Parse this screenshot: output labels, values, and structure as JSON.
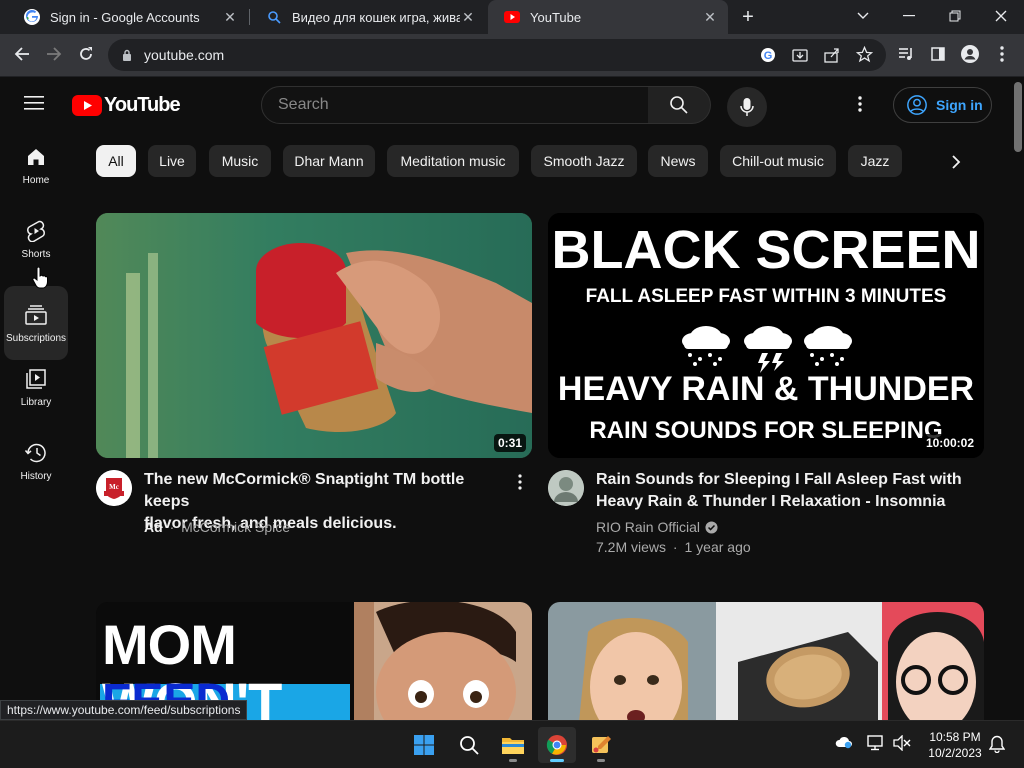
{
  "browser": {
    "tabs": [
      {
        "title": "Sign in - Google Accounts",
        "icon": "google-g-icon"
      },
      {
        "title": "Видео для кошек игра, живая м",
        "icon": "search-icon"
      },
      {
        "title": "YouTube",
        "icon": "youtube-icon",
        "active": true
      }
    ],
    "new_tab": "+",
    "url": "youtube.com",
    "status_url": "https://www.youtube.com/feed/subscriptions"
  },
  "youtube": {
    "logo_text": "YouTube",
    "search_placeholder": "Search",
    "sign_in": "Sign in",
    "guide": [
      {
        "label": "Home",
        "icon": "home-icon"
      },
      {
        "label": "Shorts",
        "icon": "shorts-icon"
      },
      {
        "label": "Subscriptions",
        "icon": "subscriptions-icon"
      },
      {
        "label": "Library",
        "icon": "library-icon"
      },
      {
        "label": "History",
        "icon": "history-icon"
      }
    ],
    "chips": [
      "All",
      "Live",
      "Music",
      "Dhar Mann",
      "Meditation music",
      "Smooth Jazz",
      "News",
      "Chill-out music",
      "Jazz"
    ],
    "videos": [
      {
        "title_line1": "The new McCormick® Snaptight TM bottle keeps",
        "title_line2": "flavor fresh, and meals delicious.",
        "ad_badge": "Ad",
        "channel": "McCormick Spice",
        "duration": "0:31"
      },
      {
        "title_line1": "Rain Sounds for Sleeping I Fall Asleep Fast with",
        "title_line2": "Heavy Rain & Thunder I Relaxation - Insomnia",
        "channel": "RIO Rain Official",
        "views": "7.2M views",
        "age": "1 year ago",
        "duration": "10:00:02",
        "thumb_text": {
          "line1": "BLACK SCREEN",
          "line2": "FALL ASLEEP FAST WITHIN 3 MINUTES",
          "line3": "HEAVY RAIN & THUNDER",
          "line4": "RAIN SOUNDS FOR SLEEPING"
        }
      },
      {
        "thumb_text": {
          "line1": "MOM WON'T",
          "line2": "FEED HUNGRY"
        }
      },
      {
        "thumb_text": {}
      }
    ]
  },
  "taskbar": {
    "time": "10:58 PM",
    "date": "10/2/2023",
    "apps": [
      "start-icon",
      "search-icon",
      "file-explorer-icon",
      "chrome-icon",
      "paint-icon"
    ]
  },
  "colors": {
    "yt_red": "#ff0000",
    "link_blue": "#3ea6ff",
    "background": "#0f0f0f"
  }
}
